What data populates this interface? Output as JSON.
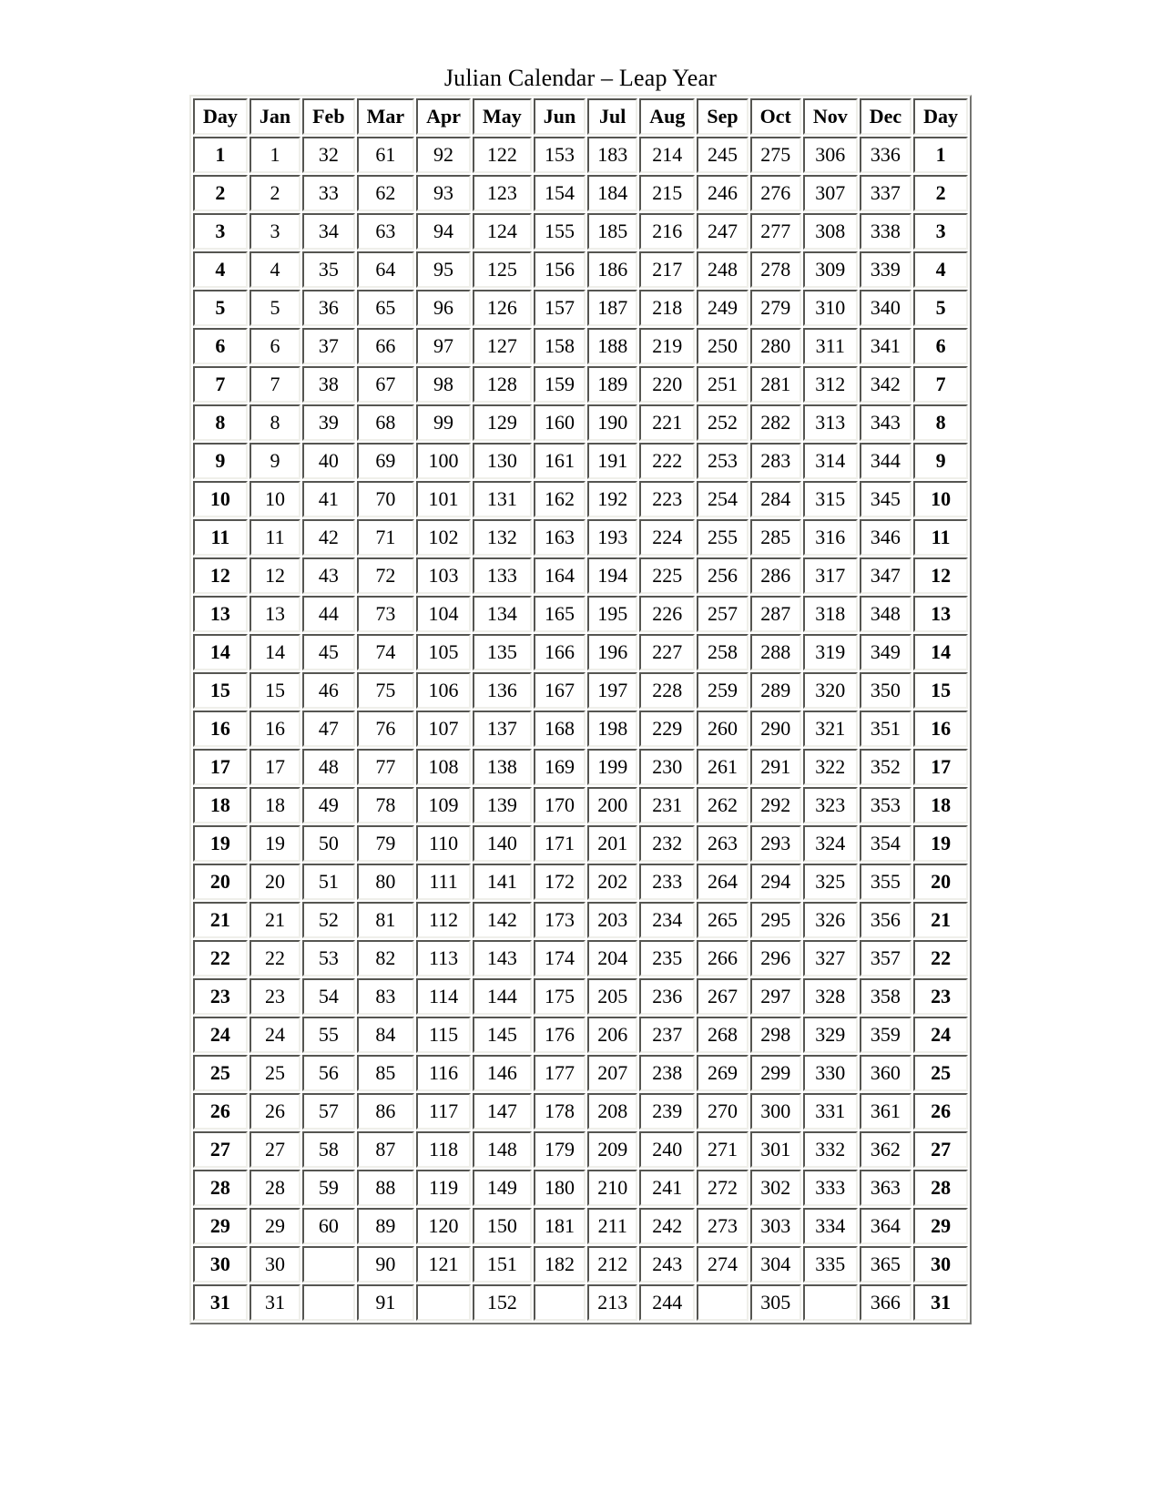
{
  "document": {
    "title": "Julian Calendar – Leap Year"
  },
  "table": {
    "name": "julian-calendar-leap-year-table",
    "headers": [
      "Day",
      "Jan",
      "Feb",
      "Mar",
      "Apr",
      "May",
      "Jun",
      "Jul",
      "Aug",
      "Sep",
      "Oct",
      "Nov",
      "Dec",
      "Day"
    ],
    "rows": [
      [
        "1",
        "1",
        "32",
        "61",
        "92",
        "122",
        "153",
        "183",
        "214",
        "245",
        "275",
        "306",
        "336",
        "1"
      ],
      [
        "2",
        "2",
        "33",
        "62",
        "93",
        "123",
        "154",
        "184",
        "215",
        "246",
        "276",
        "307",
        "337",
        "2"
      ],
      [
        "3",
        "3",
        "34",
        "63",
        "94",
        "124",
        "155",
        "185",
        "216",
        "247",
        "277",
        "308",
        "338",
        "3"
      ],
      [
        "4",
        "4",
        "35",
        "64",
        "95",
        "125",
        "156",
        "186",
        "217",
        "248",
        "278",
        "309",
        "339",
        "4"
      ],
      [
        "5",
        "5",
        "36",
        "65",
        "96",
        "126",
        "157",
        "187",
        "218",
        "249",
        "279",
        "310",
        "340",
        "5"
      ],
      [
        "6",
        "6",
        "37",
        "66",
        "97",
        "127",
        "158",
        "188",
        "219",
        "250",
        "280",
        "311",
        "341",
        "6"
      ],
      [
        "7",
        "7",
        "38",
        "67",
        "98",
        "128",
        "159",
        "189",
        "220",
        "251",
        "281",
        "312",
        "342",
        "7"
      ],
      [
        "8",
        "8",
        "39",
        "68",
        "99",
        "129",
        "160",
        "190",
        "221",
        "252",
        "282",
        "313",
        "343",
        "8"
      ],
      [
        "9",
        "9",
        "40",
        "69",
        "100",
        "130",
        "161",
        "191",
        "222",
        "253",
        "283",
        "314",
        "344",
        "9"
      ],
      [
        "10",
        "10",
        "41",
        "70",
        "101",
        "131",
        "162",
        "192",
        "223",
        "254",
        "284",
        "315",
        "345",
        "10"
      ],
      [
        "11",
        "11",
        "42",
        "71",
        "102",
        "132",
        "163",
        "193",
        "224",
        "255",
        "285",
        "316",
        "346",
        "11"
      ],
      [
        "12",
        "12",
        "43",
        "72",
        "103",
        "133",
        "164",
        "194",
        "225",
        "256",
        "286",
        "317",
        "347",
        "12"
      ],
      [
        "13",
        "13",
        "44",
        "73",
        "104",
        "134",
        "165",
        "195",
        "226",
        "257",
        "287",
        "318",
        "348",
        "13"
      ],
      [
        "14",
        "14",
        "45",
        "74",
        "105",
        "135",
        "166",
        "196",
        "227",
        "258",
        "288",
        "319",
        "349",
        "14"
      ],
      [
        "15",
        "15",
        "46",
        "75",
        "106",
        "136",
        "167",
        "197",
        "228",
        "259",
        "289",
        "320",
        "350",
        "15"
      ],
      [
        "16",
        "16",
        "47",
        "76",
        "107",
        "137",
        "168",
        "198",
        "229",
        "260",
        "290",
        "321",
        "351",
        "16"
      ],
      [
        "17",
        "17",
        "48",
        "77",
        "108",
        "138",
        "169",
        "199",
        "230",
        "261",
        "291",
        "322",
        "352",
        "17"
      ],
      [
        "18",
        "18",
        "49",
        "78",
        "109",
        "139",
        "170",
        "200",
        "231",
        "262",
        "292",
        "323",
        "353",
        "18"
      ],
      [
        "19",
        "19",
        "50",
        "79",
        "110",
        "140",
        "171",
        "201",
        "232",
        "263",
        "293",
        "324",
        "354",
        "19"
      ],
      [
        "20",
        "20",
        "51",
        "80",
        "111",
        "141",
        "172",
        "202",
        "233",
        "264",
        "294",
        "325",
        "355",
        "20"
      ],
      [
        "21",
        "21",
        "52",
        "81",
        "112",
        "142",
        "173",
        "203",
        "234",
        "265",
        "295",
        "326",
        "356",
        "21"
      ],
      [
        "22",
        "22",
        "53",
        "82",
        "113",
        "143",
        "174",
        "204",
        "235",
        "266",
        "296",
        "327",
        "357",
        "22"
      ],
      [
        "23",
        "23",
        "54",
        "83",
        "114",
        "144",
        "175",
        "205",
        "236",
        "267",
        "297",
        "328",
        "358",
        "23"
      ],
      [
        "24",
        "24",
        "55",
        "84",
        "115",
        "145",
        "176",
        "206",
        "237",
        "268",
        "298",
        "329",
        "359",
        "24"
      ],
      [
        "25",
        "25",
        "56",
        "85",
        "116",
        "146",
        "177",
        "207",
        "238",
        "269",
        "299",
        "330",
        "360",
        "25"
      ],
      [
        "26",
        "26",
        "57",
        "86",
        "117",
        "147",
        "178",
        "208",
        "239",
        "270",
        "300",
        "331",
        "361",
        "26"
      ],
      [
        "27",
        "27",
        "58",
        "87",
        "118",
        "148",
        "179",
        "209",
        "240",
        "271",
        "301",
        "332",
        "362",
        "27"
      ],
      [
        "28",
        "28",
        "59",
        "88",
        "119",
        "149",
        "180",
        "210",
        "241",
        "272",
        "302",
        "333",
        "363",
        "28"
      ],
      [
        "29",
        "29",
        "60",
        "89",
        "120",
        "150",
        "181",
        "211",
        "242",
        "273",
        "303",
        "334",
        "364",
        "29"
      ],
      [
        "30",
        "30",
        "",
        "90",
        "121",
        "151",
        "182",
        "212",
        "243",
        "274",
        "304",
        "335",
        "365",
        "30"
      ],
      [
        "31",
        "31",
        "",
        "91",
        "",
        "152",
        "",
        "213",
        "244",
        "",
        "305",
        "",
        "366",
        "31"
      ]
    ]
  }
}
